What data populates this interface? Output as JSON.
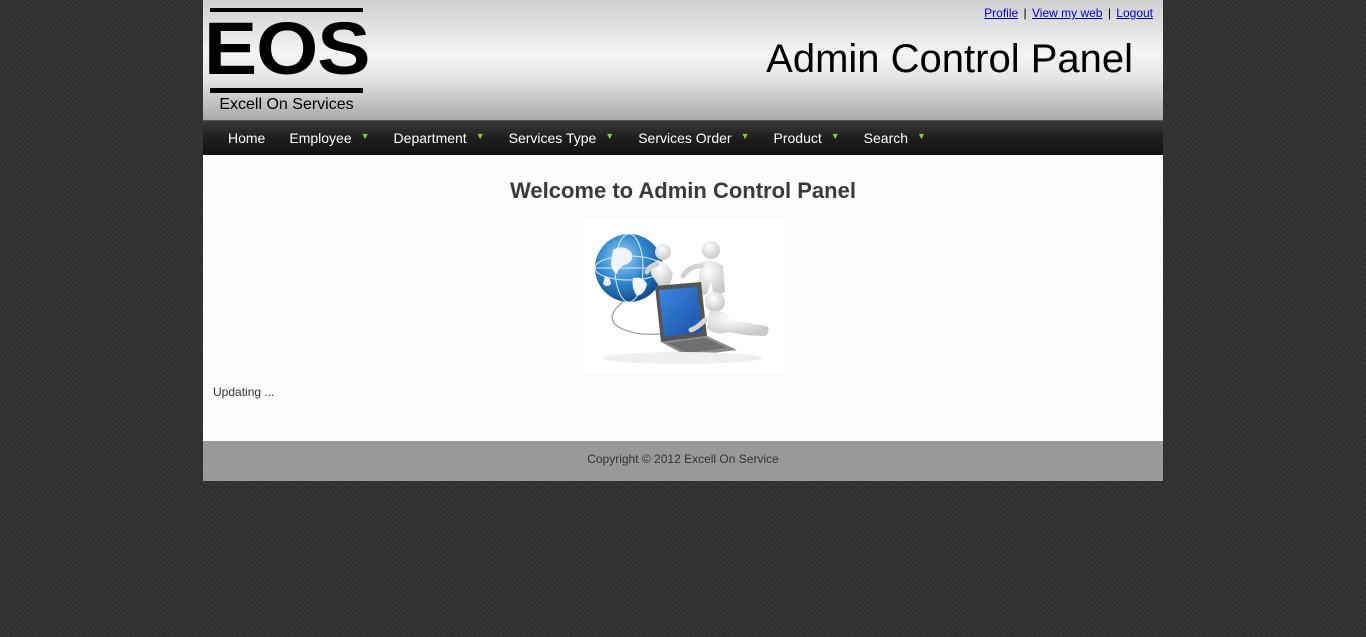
{
  "header": {
    "logo": {
      "mark": "EOS",
      "subtitle": "Excell On Services"
    },
    "title": "Admin Control Panel",
    "links": {
      "profile": "Profile",
      "view_web": "View my web",
      "logout": "Logout",
      "separator": "|"
    }
  },
  "nav": {
    "items": [
      {
        "label": "Home",
        "has_menu": false
      },
      {
        "label": "Employee",
        "has_menu": true
      },
      {
        "label": "Department",
        "has_menu": true
      },
      {
        "label": "Services Type",
        "has_menu": true
      },
      {
        "label": "Services Order",
        "has_menu": true
      },
      {
        "label": "Product",
        "has_menu": true
      },
      {
        "label": "Search",
        "has_menu": true
      }
    ],
    "chevron_icon": "chevron-down-icon",
    "chevron_color": "#8cc63f"
  },
  "main": {
    "welcome": "Welcome to Admin Control Panel",
    "hero_image": "globe-laptop-people-illustration",
    "status": "Updating ..."
  },
  "footer": {
    "copyright": "Copyright © 2012 Excell On Service"
  }
}
